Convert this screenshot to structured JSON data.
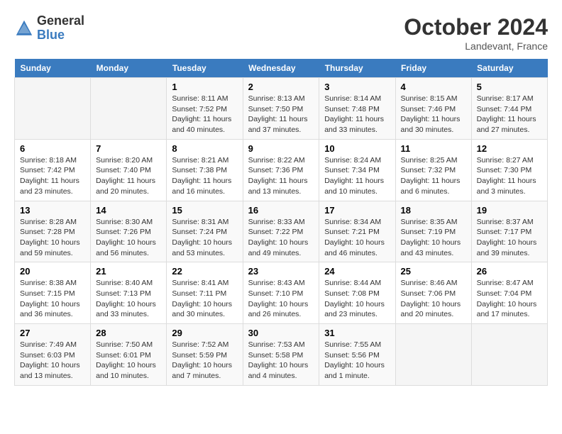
{
  "header": {
    "logo_general": "General",
    "logo_blue": "Blue",
    "title": "October 2024",
    "subtitle": "Landevant, France"
  },
  "calendar": {
    "days_of_week": [
      "Sunday",
      "Monday",
      "Tuesday",
      "Wednesday",
      "Thursday",
      "Friday",
      "Saturday"
    ],
    "weeks": [
      [
        {
          "day": "",
          "info": ""
        },
        {
          "day": "",
          "info": ""
        },
        {
          "day": "1",
          "info": "Sunrise: 8:11 AM\nSunset: 7:52 PM\nDaylight: 11 hours and 40 minutes."
        },
        {
          "day": "2",
          "info": "Sunrise: 8:13 AM\nSunset: 7:50 PM\nDaylight: 11 hours and 37 minutes."
        },
        {
          "day": "3",
          "info": "Sunrise: 8:14 AM\nSunset: 7:48 PM\nDaylight: 11 hours and 33 minutes."
        },
        {
          "day": "4",
          "info": "Sunrise: 8:15 AM\nSunset: 7:46 PM\nDaylight: 11 hours and 30 minutes."
        },
        {
          "day": "5",
          "info": "Sunrise: 8:17 AM\nSunset: 7:44 PM\nDaylight: 11 hours and 27 minutes."
        }
      ],
      [
        {
          "day": "6",
          "info": "Sunrise: 8:18 AM\nSunset: 7:42 PM\nDaylight: 11 hours and 23 minutes."
        },
        {
          "day": "7",
          "info": "Sunrise: 8:20 AM\nSunset: 7:40 PM\nDaylight: 11 hours and 20 minutes."
        },
        {
          "day": "8",
          "info": "Sunrise: 8:21 AM\nSunset: 7:38 PM\nDaylight: 11 hours and 16 minutes."
        },
        {
          "day": "9",
          "info": "Sunrise: 8:22 AM\nSunset: 7:36 PM\nDaylight: 11 hours and 13 minutes."
        },
        {
          "day": "10",
          "info": "Sunrise: 8:24 AM\nSunset: 7:34 PM\nDaylight: 11 hours and 10 minutes."
        },
        {
          "day": "11",
          "info": "Sunrise: 8:25 AM\nSunset: 7:32 PM\nDaylight: 11 hours and 6 minutes."
        },
        {
          "day": "12",
          "info": "Sunrise: 8:27 AM\nSunset: 7:30 PM\nDaylight: 11 hours and 3 minutes."
        }
      ],
      [
        {
          "day": "13",
          "info": "Sunrise: 8:28 AM\nSunset: 7:28 PM\nDaylight: 10 hours and 59 minutes."
        },
        {
          "day": "14",
          "info": "Sunrise: 8:30 AM\nSunset: 7:26 PM\nDaylight: 10 hours and 56 minutes."
        },
        {
          "day": "15",
          "info": "Sunrise: 8:31 AM\nSunset: 7:24 PM\nDaylight: 10 hours and 53 minutes."
        },
        {
          "day": "16",
          "info": "Sunrise: 8:33 AM\nSunset: 7:22 PM\nDaylight: 10 hours and 49 minutes."
        },
        {
          "day": "17",
          "info": "Sunrise: 8:34 AM\nSunset: 7:21 PM\nDaylight: 10 hours and 46 minutes."
        },
        {
          "day": "18",
          "info": "Sunrise: 8:35 AM\nSunset: 7:19 PM\nDaylight: 10 hours and 43 minutes."
        },
        {
          "day": "19",
          "info": "Sunrise: 8:37 AM\nSunset: 7:17 PM\nDaylight: 10 hours and 39 minutes."
        }
      ],
      [
        {
          "day": "20",
          "info": "Sunrise: 8:38 AM\nSunset: 7:15 PM\nDaylight: 10 hours and 36 minutes."
        },
        {
          "day": "21",
          "info": "Sunrise: 8:40 AM\nSunset: 7:13 PM\nDaylight: 10 hours and 33 minutes."
        },
        {
          "day": "22",
          "info": "Sunrise: 8:41 AM\nSunset: 7:11 PM\nDaylight: 10 hours and 30 minutes."
        },
        {
          "day": "23",
          "info": "Sunrise: 8:43 AM\nSunset: 7:10 PM\nDaylight: 10 hours and 26 minutes."
        },
        {
          "day": "24",
          "info": "Sunrise: 8:44 AM\nSunset: 7:08 PM\nDaylight: 10 hours and 23 minutes."
        },
        {
          "day": "25",
          "info": "Sunrise: 8:46 AM\nSunset: 7:06 PM\nDaylight: 10 hours and 20 minutes."
        },
        {
          "day": "26",
          "info": "Sunrise: 8:47 AM\nSunset: 7:04 PM\nDaylight: 10 hours and 17 minutes."
        }
      ],
      [
        {
          "day": "27",
          "info": "Sunrise: 7:49 AM\nSunset: 6:03 PM\nDaylight: 10 hours and 13 minutes."
        },
        {
          "day": "28",
          "info": "Sunrise: 7:50 AM\nSunset: 6:01 PM\nDaylight: 10 hours and 10 minutes."
        },
        {
          "day": "29",
          "info": "Sunrise: 7:52 AM\nSunset: 5:59 PM\nDaylight: 10 hours and 7 minutes."
        },
        {
          "day": "30",
          "info": "Sunrise: 7:53 AM\nSunset: 5:58 PM\nDaylight: 10 hours and 4 minutes."
        },
        {
          "day": "31",
          "info": "Sunrise: 7:55 AM\nSunset: 5:56 PM\nDaylight: 10 hours and 1 minute."
        },
        {
          "day": "",
          "info": ""
        },
        {
          "day": "",
          "info": ""
        }
      ]
    ]
  }
}
